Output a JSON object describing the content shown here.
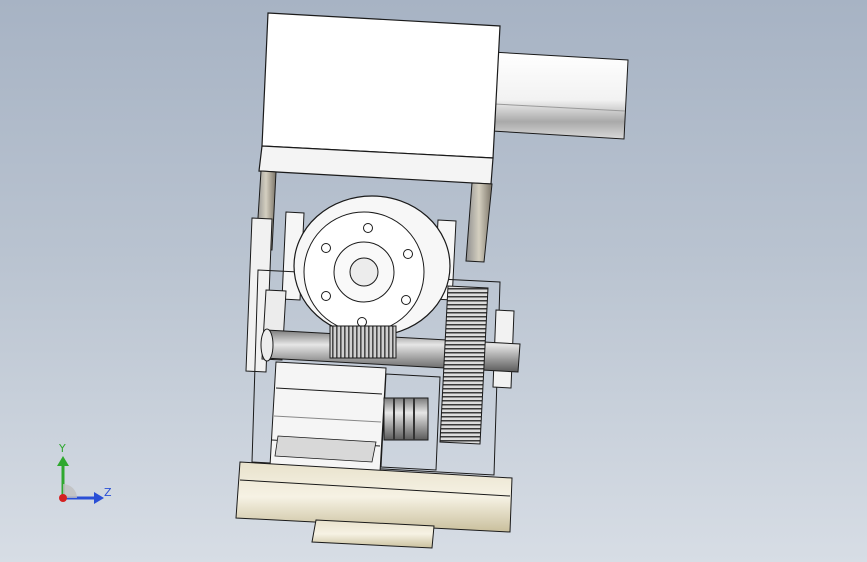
{
  "viewport": {
    "background_top": "#a7b3c4",
    "background_bottom": "#d7dde5"
  },
  "model": {
    "parts": [
      "gearmotor-housing",
      "motor-cylinder",
      "support-posts",
      "flange-bearing",
      "worm-shaft",
      "worm-gear",
      "spur-gear",
      "stepper-motor",
      "shaft-couplings",
      "base-plate",
      "base-disk"
    ],
    "line_color": "#1a1a1a",
    "body_color": "#f4f4f4",
    "metal_color": "#c8c8c8",
    "brass_color": "#d8d0b4"
  },
  "triad": {
    "y_label": "Y",
    "z_label": "Z",
    "y_color": "#2fa82f",
    "z_color": "#2a4fd6",
    "x_color": "#d42020"
  }
}
